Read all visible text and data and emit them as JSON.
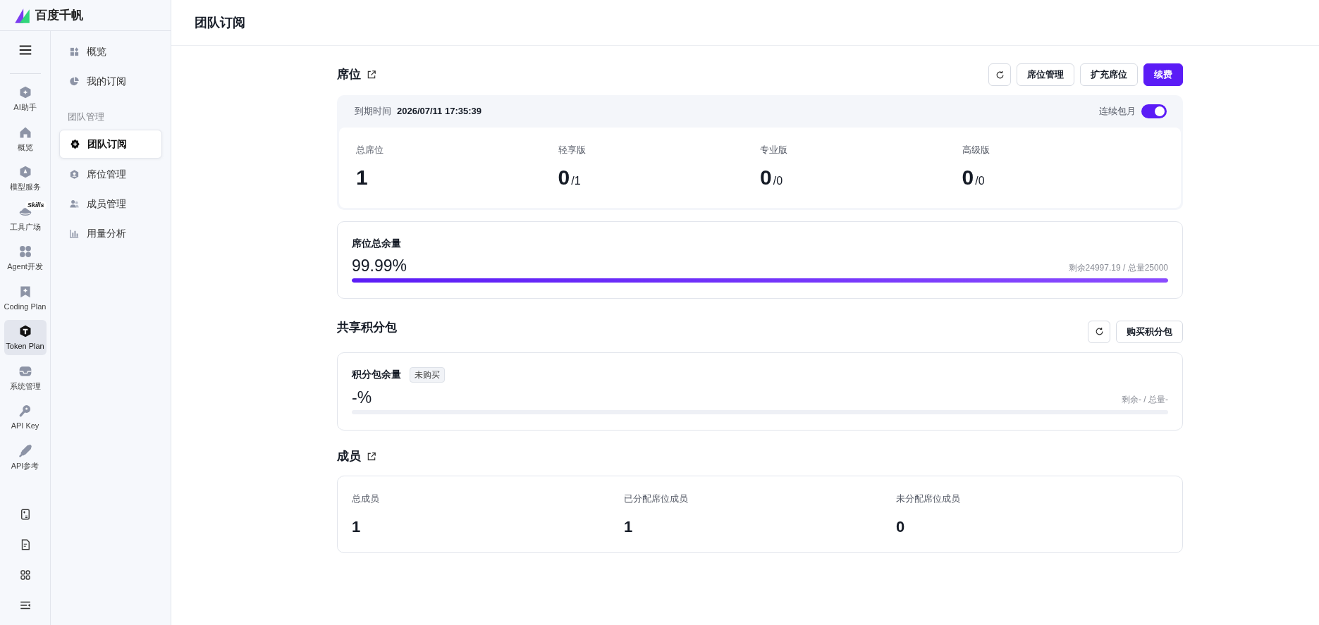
{
  "logo": {
    "text": "百度千帆"
  },
  "rail": [
    {
      "label": "AI助手",
      "selected": false
    },
    {
      "label": "概览",
      "selected": false
    },
    {
      "label": "模型服务",
      "selected": false
    },
    {
      "label": "工具广场",
      "selected": false,
      "badge": "Skills"
    },
    {
      "label": "Agent开发",
      "selected": false
    },
    {
      "label": "Coding Plan",
      "selected": false
    },
    {
      "label": "Token Plan",
      "selected": true
    },
    {
      "label": "系统管理",
      "selected": false
    },
    {
      "label": "API Key",
      "selected": false
    },
    {
      "label": "API参考",
      "selected": false
    }
  ],
  "nav": [
    {
      "kind": "item",
      "label": "概览",
      "selected": false
    },
    {
      "kind": "item",
      "label": "我的订阅",
      "selected": false
    },
    {
      "kind": "group",
      "label": "团队管理"
    },
    {
      "kind": "item",
      "label": "团队订阅",
      "selected": true
    },
    {
      "kind": "item",
      "label": "席位管理",
      "selected": false
    },
    {
      "kind": "item",
      "label": "成员管理",
      "selected": false
    },
    {
      "kind": "item",
      "label": "用量分析",
      "selected": false
    }
  ],
  "page_title": "团队订阅",
  "seats": {
    "title": "席位",
    "buttons": [
      "席位管理",
      "扩充席位",
      "续费"
    ],
    "expiry_label": "到期时间",
    "expiry": "2026/07/11 17:35:39",
    "auto_renew_label": "连续包月",
    "auto_renew_on": true,
    "stats": [
      {
        "label": "总席位",
        "value": "1"
      },
      {
        "label": "轻享版",
        "value": "0",
        "total": "/1"
      },
      {
        "label": "专业版",
        "value": "0",
        "total": "/0"
      },
      {
        "label": "高级版",
        "value": "0",
        "total": "/0"
      }
    ]
  },
  "seat_quota": {
    "title": "席位总余量",
    "percent": "99.99%",
    "level": 0.9999,
    "detail": "剩余24997.19 / 总量25000"
  },
  "points": {
    "title": "共享积分包",
    "button": "购买积分包",
    "card_title": "积分包余量",
    "tag": "未购买",
    "percent": "-%",
    "level": 0,
    "detail": "剩余- / 总量-"
  },
  "members": {
    "title": "成员",
    "stats": [
      {
        "label": "总成员",
        "value": "1"
      },
      {
        "label": "已分配席位成员",
        "value": "1"
      },
      {
        "label": "未分配席位成员",
        "value": "0"
      }
    ]
  }
}
